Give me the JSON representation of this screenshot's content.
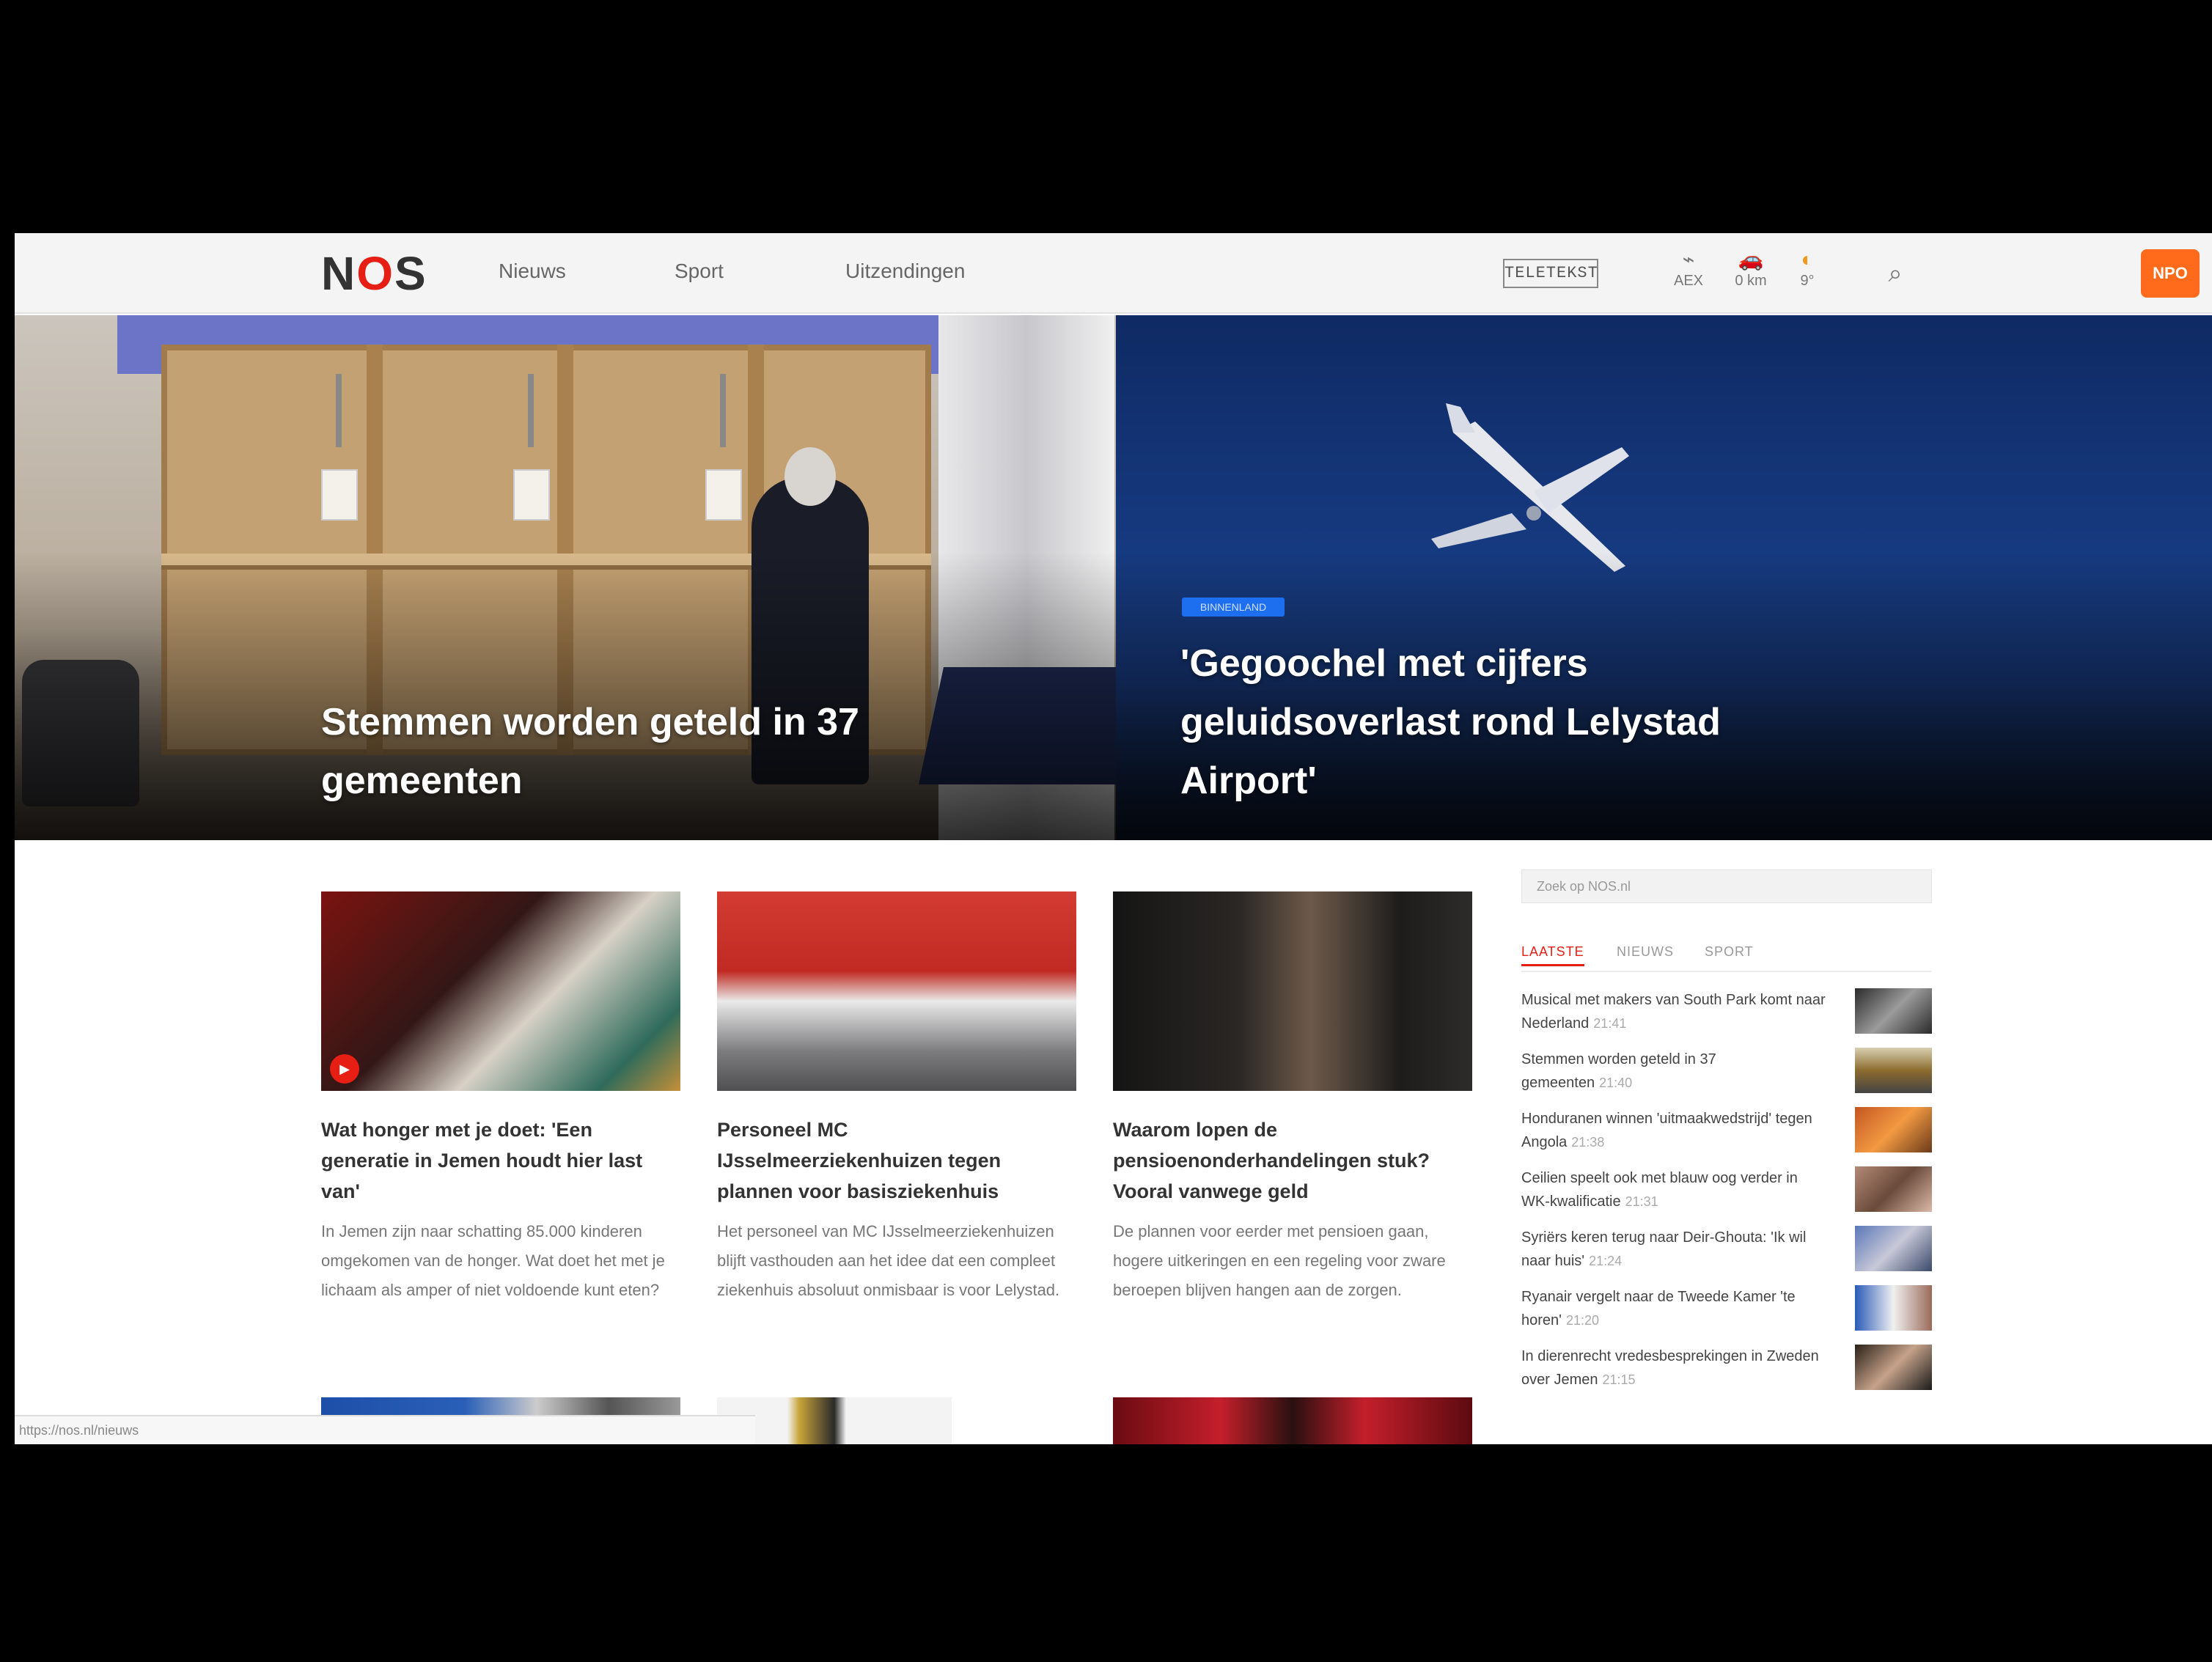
{
  "header": {
    "logo": "NOS",
    "nav": [
      "Nieuws",
      "Sport",
      "Uitzendingen"
    ],
    "teletekst": "TELETEKST",
    "widgets": [
      {
        "label": "AEX",
        "icon": "chart-icon"
      },
      {
        "label": "0 km",
        "icon": "car-icon"
      },
      {
        "label": "9°",
        "icon": "sun-icon"
      }
    ],
    "search_icon": "search-icon",
    "npo": "NPO"
  },
  "hero": {
    "left_title": "Stemmen worden geteld in 37 gemeenten",
    "right_badge": "BINNENLAND",
    "right_title": "'Gegoochel met cijfers geluidsoverlast rond Lelystad Airport'"
  },
  "articles": [
    {
      "title": "Wat honger met je doet: 'Een generatie in Jemen houdt hier last van'",
      "text": "In Jemen zijn naar schatting 85.000 kinderen omgekomen van de honger. Wat doet het met je lichaam als amper of niet voldoende kunt eten?",
      "has_video": true
    },
    {
      "title": "Personeel MC IJsselmeerziekenhuizen tegen plannen voor basisziekenhuis",
      "text": "Het personeel van MC IJsselmeerziekenhuizen blijft vasthouden aan het idee dat een compleet ziekenhuis absoluut onmisbaar is voor Lelystad.",
      "has_video": false
    },
    {
      "title": "Waarom lopen de pensioenonderhandelingen stuk? Vooral vanwege geld",
      "text": "De plannen voor eerder met pensioen gaan, hogere uitkeringen en een regeling voor zware beroepen blijven hangen aan de zorgen.",
      "has_video": false
    }
  ],
  "sidebar": {
    "search_placeholder": "Zoek op NOS.nl",
    "tabs": [
      "LAATSTE",
      "NIEUWS",
      "SPORT"
    ],
    "items": [
      {
        "text": "Musical met makers van South Park komt naar Nederland",
        "time": "21:41"
      },
      {
        "text": "Stemmen worden geteld in 37 gemeenten",
        "time": "21:40"
      },
      {
        "text": "Honduranen winnen 'uitmaakwedstrijd' tegen Angola",
        "time": "21:38"
      },
      {
        "text": "Ceilien speelt ook met blauw oog verder in WK-kwalificatie",
        "time": "21:31"
      },
      {
        "text": "Syriërs keren terug naar Deir-Ghouta: 'Ik wil naar huis'",
        "time": "21:24"
      },
      {
        "text": "Ryanair vergelt naar de Tweede Kamer 'te horen'",
        "time": "21:20"
      },
      {
        "text": "In dierenrecht vredesbesprekingen in Zweden over Jemen",
        "time": "21:15"
      }
    ]
  },
  "status_url": "https://nos.nl/nieuws"
}
